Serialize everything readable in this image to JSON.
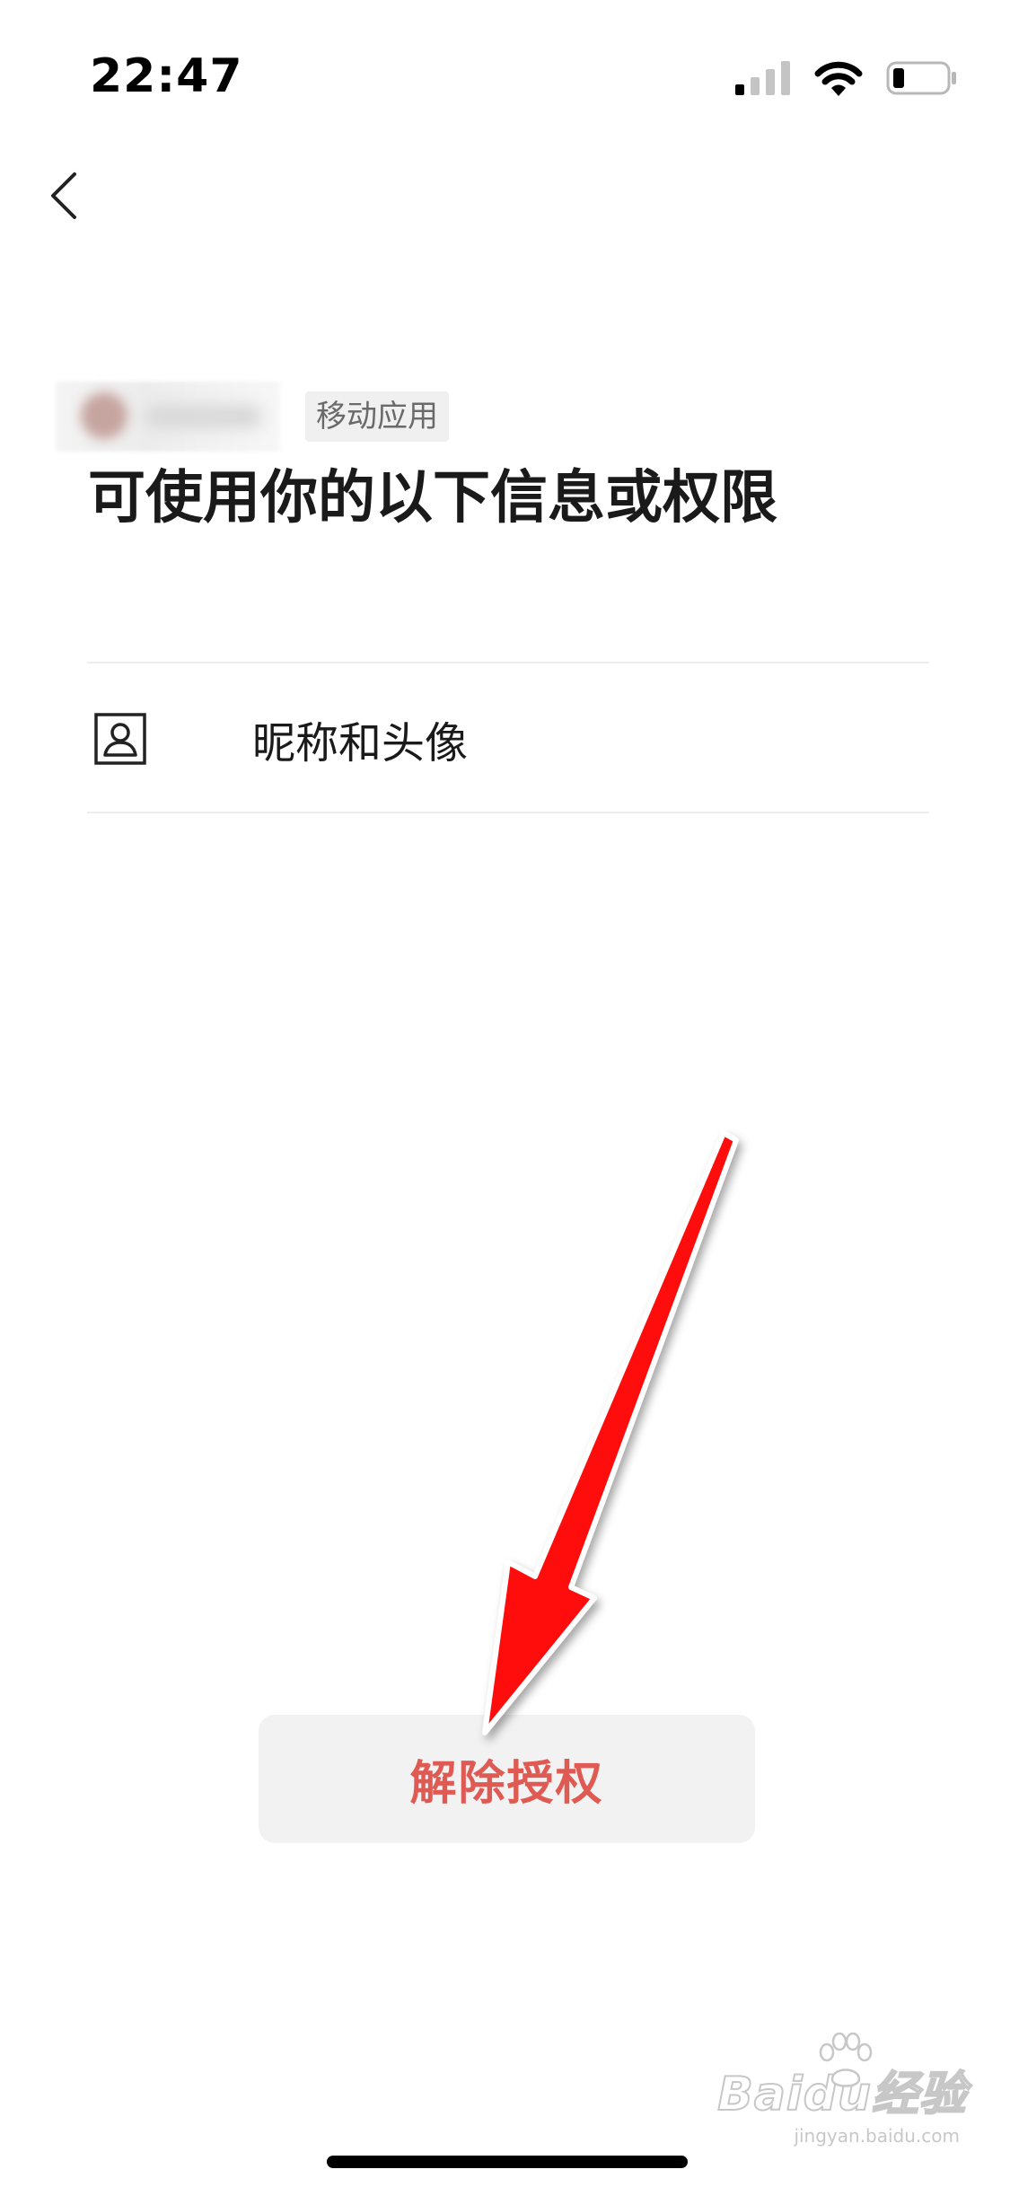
{
  "status_bar": {
    "time": "22:47",
    "signal_icon": "cellular-signal-icon",
    "wifi_icon": "wifi-icon",
    "battery_icon": "battery-low-icon"
  },
  "nav": {
    "back_icon": "chevron-left-icon"
  },
  "app": {
    "name_redacted": true,
    "tag": "移动应用"
  },
  "headline": "可使用你的以下信息或权限",
  "permissions": [
    {
      "icon": "profile-card-icon",
      "label": "昵称和头像"
    }
  ],
  "actions": {
    "revoke_label": "解除授权"
  },
  "annotation": {
    "arrow_color": "#ff0000",
    "arrow_target": "revoke-button"
  },
  "watermark": {
    "main": "Baidu经验",
    "sub": "jingyan.baidu.com"
  },
  "colors": {
    "revoke_text": "#e05a54",
    "button_bg": "#f2f2f2",
    "divider": "#ededed",
    "tag_bg": "#f0f0f0"
  }
}
